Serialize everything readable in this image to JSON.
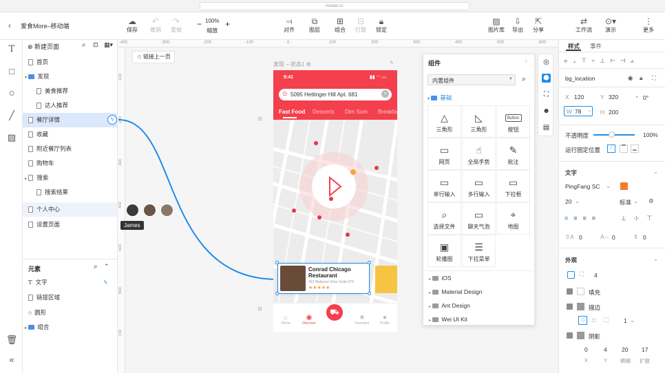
{
  "browser": {
    "url": "modao.cc"
  },
  "project": {
    "back": "‹",
    "title": "爱食More–移动端"
  },
  "toolbar": {
    "save": "保存",
    "undo": "撤销",
    "redo": "重做",
    "zoom_value": "100%",
    "zoom_label": "缩放",
    "align": "对齐",
    "layer": "图层",
    "group": "组合",
    "ungroup": "打散",
    "lock": "锁定",
    "image_lib": "图片库",
    "export": "导出",
    "share": "分享",
    "workflow": "工作流",
    "preview": "演示",
    "more": "更多"
  },
  "pages": {
    "new_page": "新建页面",
    "items": [
      {
        "label": "首页"
      },
      {
        "label": "发现"
      },
      {
        "label": "美食推荐"
      },
      {
        "label": "达人推荐"
      },
      {
        "label": "餐厅详情"
      },
      {
        "label": "收藏"
      },
      {
        "label": "附近餐厅列表"
      },
      {
        "label": "购物车"
      },
      {
        "label": "搜索"
      },
      {
        "label": "搜索结果"
      },
      {
        "label": "个人中心"
      },
      {
        "label": "设置页面"
      }
    ]
  },
  "elements": {
    "title": "元素",
    "items": [
      {
        "label": "文字"
      },
      {
        "label": "链接区域"
      },
      {
        "label": "圆形"
      },
      {
        "label": "组合"
      }
    ]
  },
  "canvas": {
    "link_prev": "链接上一页",
    "state_label": "发现 – 状态1",
    "ruler_top": [
      "-400",
      "-300",
      "-200",
      "-100",
      "0",
      "100",
      "200",
      "300",
      "400",
      "500",
      "600",
      "700",
      "800"
    ],
    "ruler_left": [
      "100",
      "200",
      "300",
      "400",
      "500",
      "600",
      "700"
    ],
    "collab_user": "James"
  },
  "phone": {
    "time": "9:41",
    "address": "5095 Hettinger Hill Apt. 681",
    "tabs": [
      "Fast Food",
      "Desserts",
      "Dim Sum",
      "Breakfast"
    ],
    "card_title_1": "Conrad Chicago",
    "card_title_2": "Restaurant",
    "card_addr": "963 Madyson Drive Suite 679",
    "stars": "★★★★★",
    "nav": [
      "Home",
      "Discover",
      "",
      "Favorites",
      "Profile"
    ],
    "accent": "#f43f4c"
  },
  "components": {
    "title": "组件",
    "dropdown": "内置组件",
    "category": "基础",
    "items": [
      {
        "label": "三角形",
        "icon": "△"
      },
      {
        "label": "三角形",
        "icon": "◺"
      },
      {
        "label": "按钮",
        "icon": "Button"
      },
      {
        "label": "网页",
        "icon": "▭"
      },
      {
        "label": "全局手势",
        "icon": "☝"
      },
      {
        "label": "批注",
        "icon": "✎"
      },
      {
        "label": "单行输入",
        "icon": "▭"
      },
      {
        "label": "多行输入",
        "icon": "▭"
      },
      {
        "label": "下拉框",
        "icon": "▭"
      },
      {
        "label": "选择文件",
        "icon": "⌕"
      },
      {
        "label": "聊天气泡",
        "icon": "▭"
      },
      {
        "label": "地图",
        "icon": "⌖"
      },
      {
        "label": "轮播图",
        "icon": "▣"
      },
      {
        "label": "下拉菜单",
        "icon": "☰"
      }
    ],
    "libraries": [
      "iOS",
      "Material Design",
      "Ant Design",
      "Wei UI Kit"
    ]
  },
  "props": {
    "tab_style": "样式",
    "tab_event": "事件",
    "name": "bg_location",
    "x_label": "X",
    "x": "120",
    "y_label": "Y",
    "y": "320",
    "rot": "0°",
    "w_label": "W",
    "w": "78",
    "h_label": "H",
    "h": "200",
    "opacity_label": "不透明度",
    "opacity": "100%",
    "fixed_label": "运行固定位置",
    "text_section": "文字",
    "font": "PingFang SC",
    "font_color": "#f47c30",
    "font_size": "20",
    "weight": "标准",
    "spacing": [
      "0",
      "0",
      "0"
    ],
    "appearance": "外观",
    "radius": "4",
    "fill": "填充",
    "stroke": "描边",
    "stroke_w": "1",
    "shadow": "阴影",
    "shadow_vals": [
      "0",
      "4",
      "20",
      "17"
    ],
    "shadow_labels": [
      "X",
      "Y",
      "模糊",
      "扩散"
    ]
  }
}
